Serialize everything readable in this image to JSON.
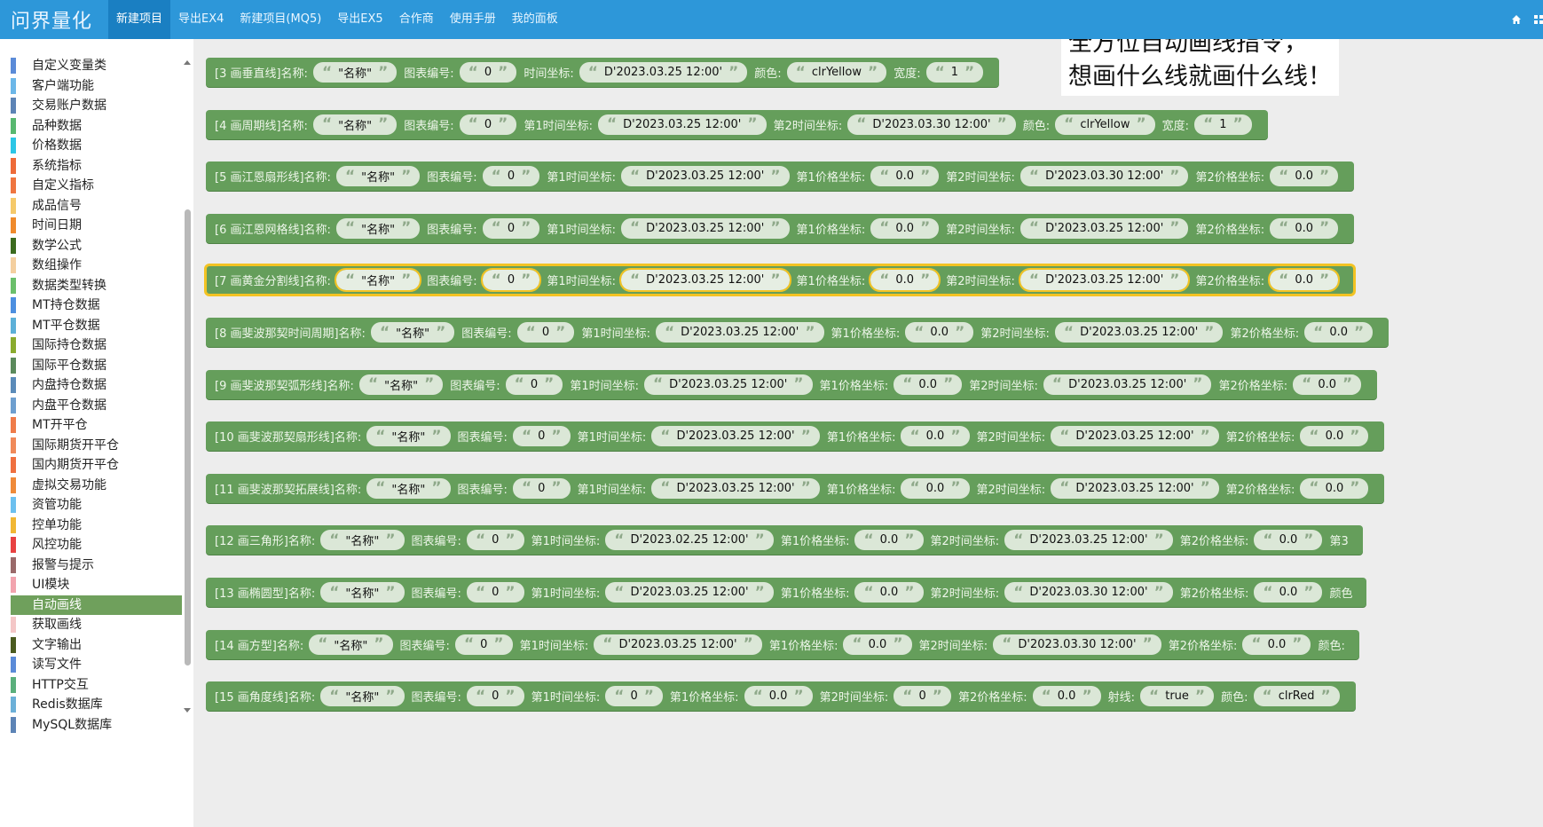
{
  "app": {
    "logo": "问界量化",
    "nav": [
      "新建项目",
      "导出EX4",
      "新建项目(MQ5)",
      "导出EX5",
      "合作商",
      "使用手册",
      "我的面板"
    ],
    "nav_active_index": 0,
    "right_icons": [
      "home-icon",
      "grid-icon"
    ]
  },
  "sidebar": {
    "active_index": 27,
    "items": [
      {
        "label": "自定义变量类",
        "color": "#5b8bd8"
      },
      {
        "label": "客户端功能",
        "color": "#6cb7e8"
      },
      {
        "label": "交易账户数据",
        "color": "#5d84b6"
      },
      {
        "label": "品种数据",
        "color": "#58b870"
      },
      {
        "label": "价格数据",
        "color": "#2cc6e6"
      },
      {
        "label": "系统指标",
        "color": "#ee6b39"
      },
      {
        "label": "自定义指标",
        "color": "#ef7540"
      },
      {
        "label": "成品信号",
        "color": "#f5c96a"
      },
      {
        "label": "时间日期",
        "color": "#ef8a2c"
      },
      {
        "label": "数学公式",
        "color": "#3c6b1f"
      },
      {
        "label": "数组操作",
        "color": "#f4cf9f"
      },
      {
        "label": "数据类型转换",
        "color": "#6bbf6b"
      },
      {
        "label": "MT持仓数据",
        "color": "#4d8fe0"
      },
      {
        "label": "MT平仓数据",
        "color": "#5db0d8"
      },
      {
        "label": "国际持仓数据",
        "color": "#8aab2e"
      },
      {
        "label": "国际平仓数据",
        "color": "#5b8a5c"
      },
      {
        "label": "内盘持仓数据",
        "color": "#5b8bb9"
      },
      {
        "label": "内盘平仓数据",
        "color": "#6e9fcf"
      },
      {
        "label": "MT开平仓",
        "color": "#ef7c4a"
      },
      {
        "label": "国际期货开平仓",
        "color": "#f08a5a"
      },
      {
        "label": "国内期货开平仓",
        "color": "#ef7040"
      },
      {
        "label": "虚拟交易功能",
        "color": "#ef8a3a"
      },
      {
        "label": "资管功能",
        "color": "#6cc0ef"
      },
      {
        "label": "控单功能",
        "color": "#f1b734"
      },
      {
        "label": "风控功能",
        "color": "#e84242"
      },
      {
        "label": "报警与提示",
        "color": "#9a6a6a"
      },
      {
        "label": "UI模块",
        "color": "#f2a4ae"
      },
      {
        "label": "自动画线",
        "color": "#6fa05c"
      },
      {
        "label": "获取画线",
        "color": "#f4c7c7"
      },
      {
        "label": "文字输出",
        "color": "#4b5b20"
      },
      {
        "label": "读写文件",
        "color": "#5b8bd8"
      },
      {
        "label": "HTTP交互",
        "color": "#5aaf7c"
      },
      {
        "label": "Redis数据库",
        "color": "#6cb0d8"
      },
      {
        "label": "MySQL数据库",
        "color": "#5d84b6"
      }
    ]
  },
  "workspace": {
    "headline": [
      "全方位自动画线指令，",
      "想画什么线就画什么线！"
    ],
    "block_color": "#659e5b",
    "selected_block_index": 4,
    "blocks": [
      {
        "label": "[3 画垂直线]名称:",
        "parts": [
          {
            "value": "\"名称\""
          },
          {
            "label": "图表编号:",
            "value": "0"
          },
          {
            "label": "时间坐标:",
            "value": "D'2023.03.25 12:00'"
          },
          {
            "label": "颜色:",
            "value": "clrYellow"
          },
          {
            "label": "宽度:",
            "value": "1"
          }
        ]
      },
      {
        "label": "[4 画周期线]名称:",
        "parts": [
          {
            "value": "\"名称\""
          },
          {
            "label": "图表编号:",
            "value": "0"
          },
          {
            "label": "第1时间坐标:",
            "value": "D'2023.03.25 12:00'"
          },
          {
            "label": "第2时间坐标:",
            "value": "D'2023.03.30 12:00'"
          },
          {
            "label": "颜色:",
            "value": "clrYellow"
          },
          {
            "label": "宽度:",
            "value": "1"
          }
        ]
      },
      {
        "label": "[5 画江恩扇形线]名称:",
        "parts": [
          {
            "value": "\"名称\""
          },
          {
            "label": "图表编号:",
            "value": "0"
          },
          {
            "label": "第1时间坐标:",
            "value": "D'2023.03.25 12:00'"
          },
          {
            "label": "第1价格坐标:",
            "value": "0.0"
          },
          {
            "label": "第2时间坐标:",
            "value": "D'2023.03.30 12:00'"
          },
          {
            "label": "第2价格坐标:",
            "value": "0.0"
          }
        ]
      },
      {
        "label": "[6 画江恩网格线]名称:",
        "parts": [
          {
            "value": "\"名称\""
          },
          {
            "label": "图表编号:",
            "value": "0"
          },
          {
            "label": "第1时间坐标:",
            "value": "D'2023.03.25 12:00'"
          },
          {
            "label": "第1价格坐标:",
            "value": "0.0"
          },
          {
            "label": "第2时间坐标:",
            "value": "D'2023.03.25 12:00'"
          },
          {
            "label": "第2价格坐标:",
            "value": "0.0"
          }
        ]
      },
      {
        "label": "[7 画黄金分割线]名称:",
        "parts": [
          {
            "value": "\"名称\""
          },
          {
            "label": "图表编号:",
            "value": "0"
          },
          {
            "label": "第1时间坐标:",
            "value": "D'2023.03.25 12:00'"
          },
          {
            "label": "第1价格坐标:",
            "value": "0.0"
          },
          {
            "label": "第2时间坐标:",
            "value": "D'2023.03.25 12:00'"
          },
          {
            "label": "第2价格坐标:",
            "value": "0.0"
          }
        ]
      },
      {
        "label": "[8 画斐波那契时间周期]名称:",
        "parts": [
          {
            "value": "\"名称\""
          },
          {
            "label": "图表编号:",
            "value": "0"
          },
          {
            "label": "第1时间坐标:",
            "value": "D'2023.03.25 12:00'"
          },
          {
            "label": "第1价格坐标:",
            "value": "0.0"
          },
          {
            "label": "第2时间坐标:",
            "value": "D'2023.03.25 12:00'"
          },
          {
            "label": "第2价格坐标:",
            "value": "0.0"
          }
        ]
      },
      {
        "label": "[9 画斐波那契弧形线]名称:",
        "parts": [
          {
            "value": "\"名称\""
          },
          {
            "label": "图表编号:",
            "value": "0"
          },
          {
            "label": "第1时间坐标:",
            "value": "D'2023.03.25 12:00'"
          },
          {
            "label": "第1价格坐标:",
            "value": "0.0"
          },
          {
            "label": "第2时间坐标:",
            "value": "D'2023.03.25 12:00'"
          },
          {
            "label": "第2价格坐标:",
            "value": "0.0"
          }
        ]
      },
      {
        "label": "[10 画斐波那契扇形线]名称:",
        "parts": [
          {
            "value": "\"名称\""
          },
          {
            "label": "图表编号:",
            "value": "0"
          },
          {
            "label": "第1时间坐标:",
            "value": "D'2023.03.25 12:00'"
          },
          {
            "label": "第1价格坐标:",
            "value": "0.0"
          },
          {
            "label": "第2时间坐标:",
            "value": "D'2023.03.25 12:00'"
          },
          {
            "label": "第2价格坐标:",
            "value": "0.0"
          }
        ]
      },
      {
        "label": "[11 画斐波那契拓展线]名称:",
        "parts": [
          {
            "value": "\"名称\""
          },
          {
            "label": "图表编号:",
            "value": "0"
          },
          {
            "label": "第1时间坐标:",
            "value": "D'2023.03.25 12:00'"
          },
          {
            "label": "第1价格坐标:",
            "value": "0.0"
          },
          {
            "label": "第2时间坐标:",
            "value": "D'2023.03.25 12:00'"
          },
          {
            "label": "第2价格坐标:",
            "value": "0.0"
          }
        ]
      },
      {
        "label": "[12 画三角形]名称:",
        "parts": [
          {
            "value": "\"名称\""
          },
          {
            "label": "图表编号:",
            "value": "0"
          },
          {
            "label": "第1时间坐标:",
            "value": "D'2023.02.25 12:00'"
          },
          {
            "label": "第1价格坐标:",
            "value": "0.0"
          },
          {
            "label": "第2时间坐标:",
            "value": "D'2023.03.25 12:00'"
          },
          {
            "label": "第2价格坐标:",
            "value": "0.0"
          },
          {
            "label": "第3"
          }
        ]
      },
      {
        "label": "[13 画椭圆型]名称:",
        "parts": [
          {
            "value": "\"名称\""
          },
          {
            "label": "图表编号:",
            "value": "0"
          },
          {
            "label": "第1时间坐标:",
            "value": "D'2023.03.25 12:00'"
          },
          {
            "label": "第1价格坐标:",
            "value": "0.0"
          },
          {
            "label": "第2时间坐标:",
            "value": "D'2023.03.30 12:00'"
          },
          {
            "label": "第2价格坐标:",
            "value": "0.0"
          },
          {
            "label": "颜色"
          }
        ]
      },
      {
        "label": "[14 画方型]名称:",
        "parts": [
          {
            "value": "\"名称\""
          },
          {
            "label": "图表编号:",
            "value": "0"
          },
          {
            "label": "第1时间坐标:",
            "value": "D'2023.03.25 12:00'"
          },
          {
            "label": "第1价格坐标:",
            "value": "0.0"
          },
          {
            "label": "第2时间坐标:",
            "value": "D'2023.03.30 12:00'"
          },
          {
            "label": "第2价格坐标:",
            "value": "0.0"
          },
          {
            "label": "颜色:"
          }
        ]
      },
      {
        "label": "[15 画角度线]名称:",
        "parts": [
          {
            "value": "\"名称\""
          },
          {
            "label": "图表编号:",
            "value": "0"
          },
          {
            "label": "第1时间坐标:",
            "value": "0"
          },
          {
            "label": "第1价格坐标:",
            "value": "0.0"
          },
          {
            "label": "第2时间坐标:",
            "value": "0"
          },
          {
            "label": "第2价格坐标:",
            "value": "0.0"
          },
          {
            "label": "射线:",
            "value": "true"
          },
          {
            "label": "颜色:",
            "value": "clrRed"
          }
        ]
      }
    ]
  }
}
